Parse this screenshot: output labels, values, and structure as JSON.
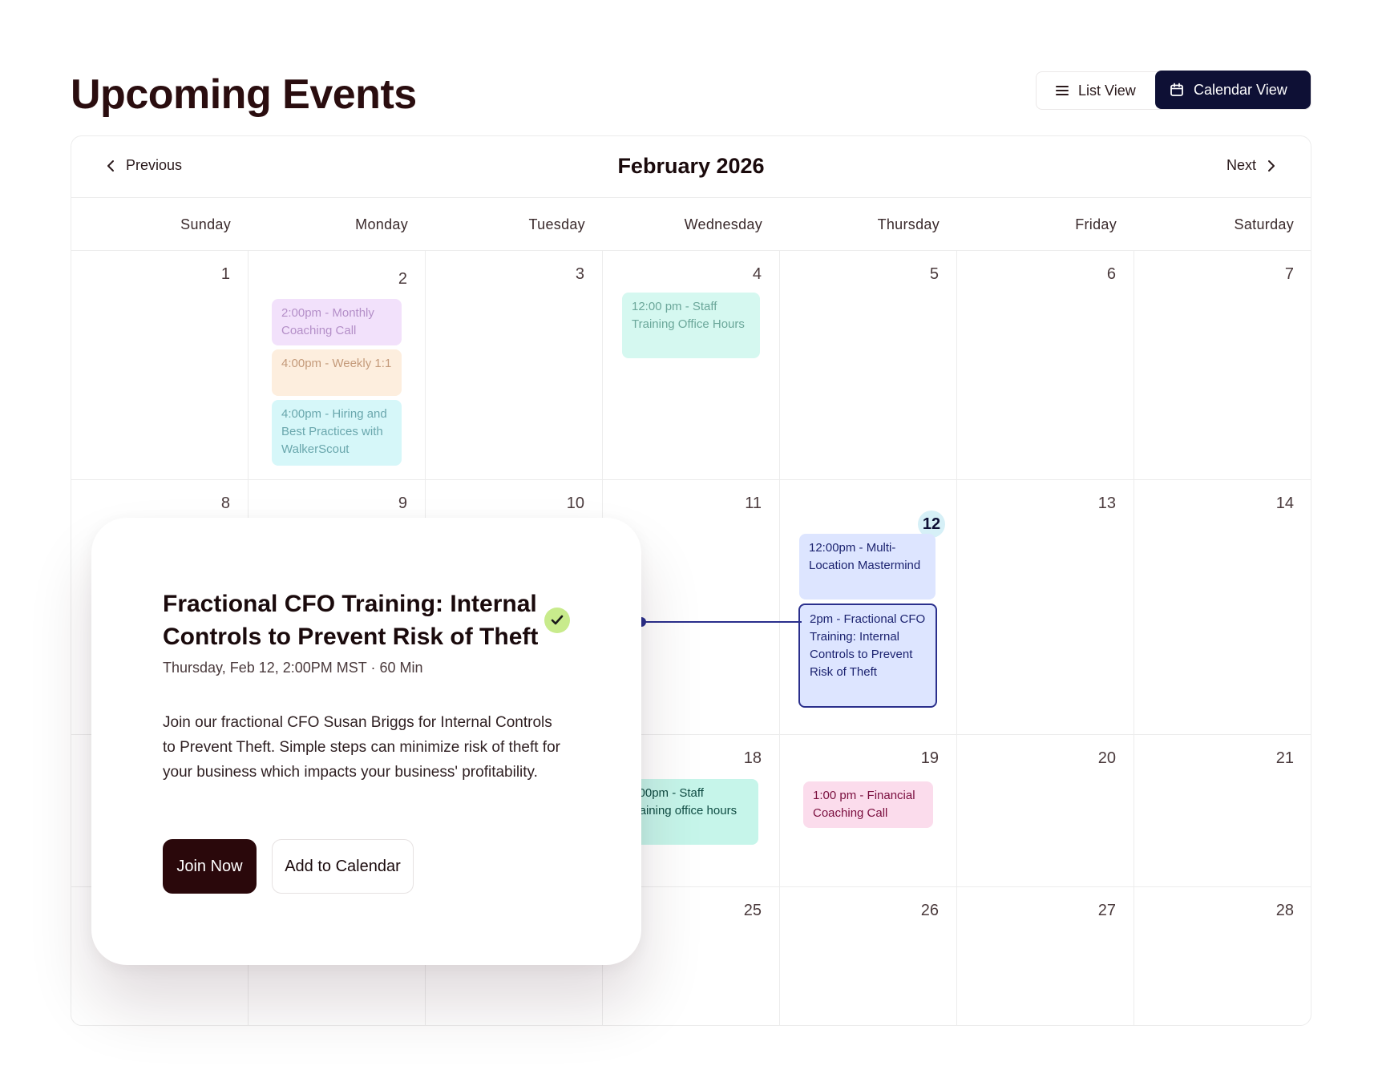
{
  "header": {
    "title": "Upcoming Events",
    "view_toggle": {
      "list_label": "List View",
      "calendar_label": "Calendar View",
      "active": "calendar"
    }
  },
  "calendar": {
    "month_title": "February 2026",
    "prev_label": "Previous",
    "next_label": "Next",
    "weekdays": [
      "Sunday",
      "Monday",
      "Tuesday",
      "Wednesday",
      "Thursday",
      "Friday",
      "Saturday"
    ],
    "days": {
      "d1": "1",
      "d2": "2",
      "d3": "3",
      "d4": "4",
      "d5": "5",
      "d6": "6",
      "d7": "7",
      "d8": "8",
      "d9": "9",
      "d10": "10",
      "d11": "11",
      "d12": "12",
      "d13": "13",
      "d14": "14",
      "d18": "18",
      "d19": "19",
      "d20": "20",
      "d21": "21",
      "d25": "25",
      "d26": "26",
      "d27": "27",
      "d28": "28"
    },
    "today": "12",
    "events": {
      "e1": "2:00pm - Monthly Coaching Call",
      "e2": "4:00pm - Weekly 1:1",
      "e3": "4:00pm - Hiring and Best Practices with WalkerScout",
      "e4": "12:00 pm - Staff Training Office Hours",
      "e5": "12:00pm - Multi-Location Mastermind",
      "e6": "2pm - Fractional CFO Training: Internal Controls to Prevent Risk of Theft",
      "e7": "2:00pm - Staff Training office hours",
      "e8": "1:00 pm - Financial Coaching Call"
    }
  },
  "popup": {
    "title": "Fractional CFO Training: Internal Controls to Prevent Risk of Theft",
    "meta": "Thursday, Feb 12, 2:00PM MST · 60 Min",
    "description": "Join our fractional CFO Susan Briggs for Internal Controls to Prevent Theft. Simple steps can minimize risk of theft for your business which impacts your business' profitability.",
    "join_label": "Join Now",
    "add_label": "Add to Calendar",
    "check_icon": "check-circle-icon"
  },
  "colors": {
    "primary_dark": "#0e1035",
    "join_button": "#2a080b",
    "selected_event_border": "#2a2f8c",
    "today_badge": "#d6f0f7"
  }
}
